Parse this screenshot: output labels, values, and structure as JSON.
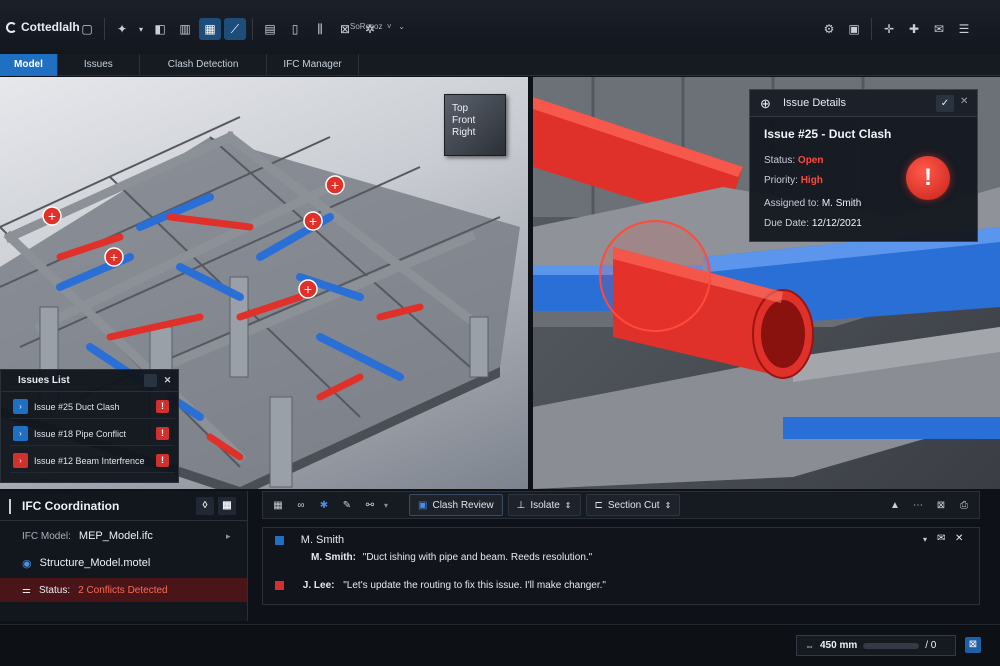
{
  "app": {
    "title": "Cottedlalh",
    "search_text": "SoRecoz"
  },
  "tabs": [
    {
      "label": "Model",
      "active": true
    },
    {
      "label": "Issues",
      "active": false
    },
    {
      "label": "Clash Detection",
      "active": false
    },
    {
      "label": "IFC Manager",
      "active": false
    }
  ],
  "viewcube": {
    "top": "Top",
    "front": "Front",
    "right": "Right"
  },
  "issues_list": {
    "title": "Issues List",
    "items": [
      {
        "label": "Issue #25 Duct Clash",
        "color": "#1f6fc2"
      },
      {
        "label": "Issue #18 Pipe Conflict",
        "color": "#1f6fc2"
      },
      {
        "label": "Issue #12 Beam Interfrence",
        "color": "#d0312d"
      }
    ]
  },
  "issue_details": {
    "header": "Issue Details",
    "title": "Issue #25 - Duct Clash",
    "status_label": "Status:",
    "status_value": "Open",
    "priority_label": "Priority:",
    "priority_value": "High",
    "assigned_label": "Assigned to:",
    "assigned_value": "M. Smith",
    "due_label": "Due Date:",
    "due_value": "12/12/2021"
  },
  "ifc": {
    "title": "IFC Coordination",
    "model_label": "IFC Model:",
    "model_value": "MEP_Model.ifc",
    "structure_model": "Structure_Model.motel",
    "status_label": "Status:",
    "status_value": "2 Conflicts Detected"
  },
  "comm_toolbar": {
    "clash_review": "Clash Review",
    "isolate": "Isolate",
    "section_cut": "Section Cut"
  },
  "comments": {
    "header_author": "M. Smith",
    "messages": [
      {
        "author": "M. Smith:",
        "text": "\"Duct ishing with pipe and beam. Reeds resolution.\""
      },
      {
        "author": "J. Lee:",
        "text": "\"Let's update the routing to fix this issue. I'll make changer.\""
      }
    ]
  },
  "statusbar": {
    "zoom": "450 mm",
    "counter": "/ 0"
  },
  "colors": {
    "accent": "#1f6fc2",
    "danger": "#d0312d",
    "duct_red": "#e0302a",
    "pipe_blue": "#2a6fd6"
  }
}
